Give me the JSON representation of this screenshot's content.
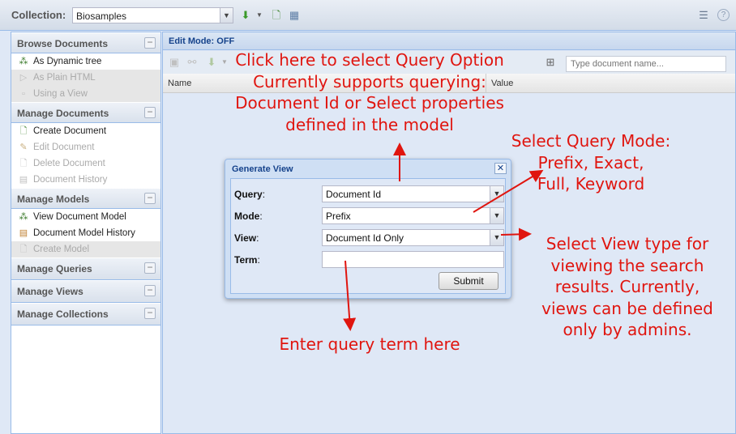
{
  "topbar": {
    "collection_label": "Collection:",
    "collection_value": "Biosamples"
  },
  "sidebar": {
    "sections": [
      {
        "title": "Browse Documents",
        "items": [
          {
            "label": "As Dynamic tree",
            "enabled": true
          },
          {
            "label": "As Plain HTML",
            "enabled": false
          },
          {
            "label": "Using a View",
            "enabled": false
          }
        ]
      },
      {
        "title": "Manage Documents",
        "items": [
          {
            "label": "Create Document",
            "enabled": true
          },
          {
            "label": "Edit Document",
            "enabled": false
          },
          {
            "label": "Delete Document",
            "enabled": false
          },
          {
            "label": "Document History",
            "enabled": false
          }
        ]
      },
      {
        "title": "Manage Models",
        "items": [
          {
            "label": "View Document Model",
            "enabled": true
          },
          {
            "label": "Document Model History",
            "enabled": true
          },
          {
            "label": "Create Model",
            "enabled": false
          }
        ]
      },
      {
        "title": "Manage Queries",
        "items": []
      },
      {
        "title": "Manage Views",
        "items": []
      },
      {
        "title": "Manage Collections",
        "items": []
      }
    ]
  },
  "main": {
    "edit_mode": "Edit Mode: OFF",
    "search_placeholder": "Type document name...",
    "columns": [
      "Name",
      "Value"
    ]
  },
  "modal": {
    "title": "Generate View",
    "fields": {
      "query": {
        "label": "Query",
        "value": "Document Id"
      },
      "mode": {
        "label": "Mode",
        "value": "Prefix"
      },
      "view": {
        "label": "View",
        "value": "Document Id Only"
      },
      "term": {
        "label": "Term",
        "value": ""
      }
    },
    "submit_label": "Submit"
  },
  "annotations": {
    "query_option": [
      "Click here to select Query Option",
      "Currently supports querying:",
      "Document Id or Select properties",
      "defined in the model"
    ],
    "query_mode": [
      "Select Query Mode:",
      "Prefix, Exact,",
      "Full, Keyword"
    ],
    "view_type": [
      "Select View type for",
      "viewing the search",
      "results. Currently,",
      "views can be defined",
      "only by admins."
    ],
    "term": [
      "Enter query term here"
    ]
  },
  "colors": {
    "annotation": "#e0150f",
    "panel_title": "#15428b",
    "background": "#dfe8f6"
  }
}
